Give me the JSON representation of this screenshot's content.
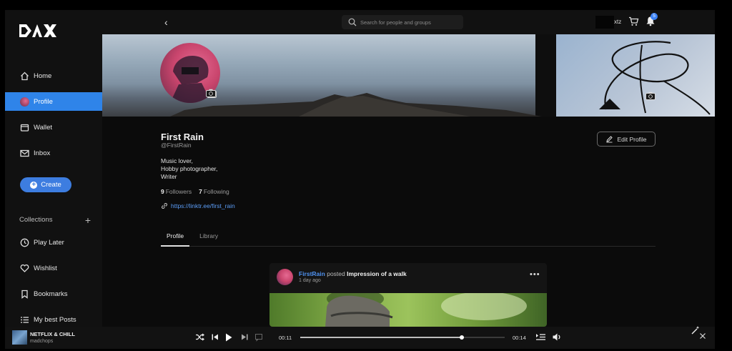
{
  "app": {
    "logo_text": "DAX"
  },
  "sidebar": {
    "items": [
      {
        "label": "Home",
        "icon": "home-icon"
      },
      {
        "label": "Profile",
        "icon": "avatar-icon",
        "active": true
      },
      {
        "label": "Wallet",
        "icon": "wallet-icon"
      },
      {
        "label": "Inbox",
        "icon": "mail-icon"
      }
    ],
    "create_label": "Create",
    "collections_label": "Collections",
    "collection_items": [
      {
        "label": "Play Later",
        "icon": "clock-icon"
      },
      {
        "label": "Wishlist",
        "icon": "heart-icon"
      },
      {
        "label": "Bookmarks",
        "icon": "bookmark-icon"
      },
      {
        "label": "My best Posts",
        "icon": "list-icon"
      }
    ]
  },
  "topbar": {
    "search_placeholder": "Search for people and groups",
    "user_label": "xtz",
    "notification_count": "5"
  },
  "profile": {
    "name": "First Rain",
    "handle": "@FirstRain",
    "bio": [
      "Music lover,",
      "Hobby photographer,",
      "Writer"
    ],
    "followers_count": "9",
    "followers_label": "Followers",
    "following_count": "7",
    "following_label": "Following",
    "link": "https://linktr.ee/first_rain",
    "edit_label": "Edit Profile",
    "tabs": [
      {
        "label": "Profile",
        "active": true
      },
      {
        "label": "Library"
      }
    ]
  },
  "post": {
    "author": "FirstRain",
    "verb": "posted",
    "title": "Impression of a walk",
    "time": "1 day ago",
    "more": "•••"
  },
  "player": {
    "track": "NETFLIX & CHILL",
    "artist": "madchops",
    "elapsed": "00:11",
    "remaining": "00:14",
    "progress": 0.79
  },
  "colors": {
    "accent": "#2f84e9",
    "link": "#5b9cf5"
  }
}
